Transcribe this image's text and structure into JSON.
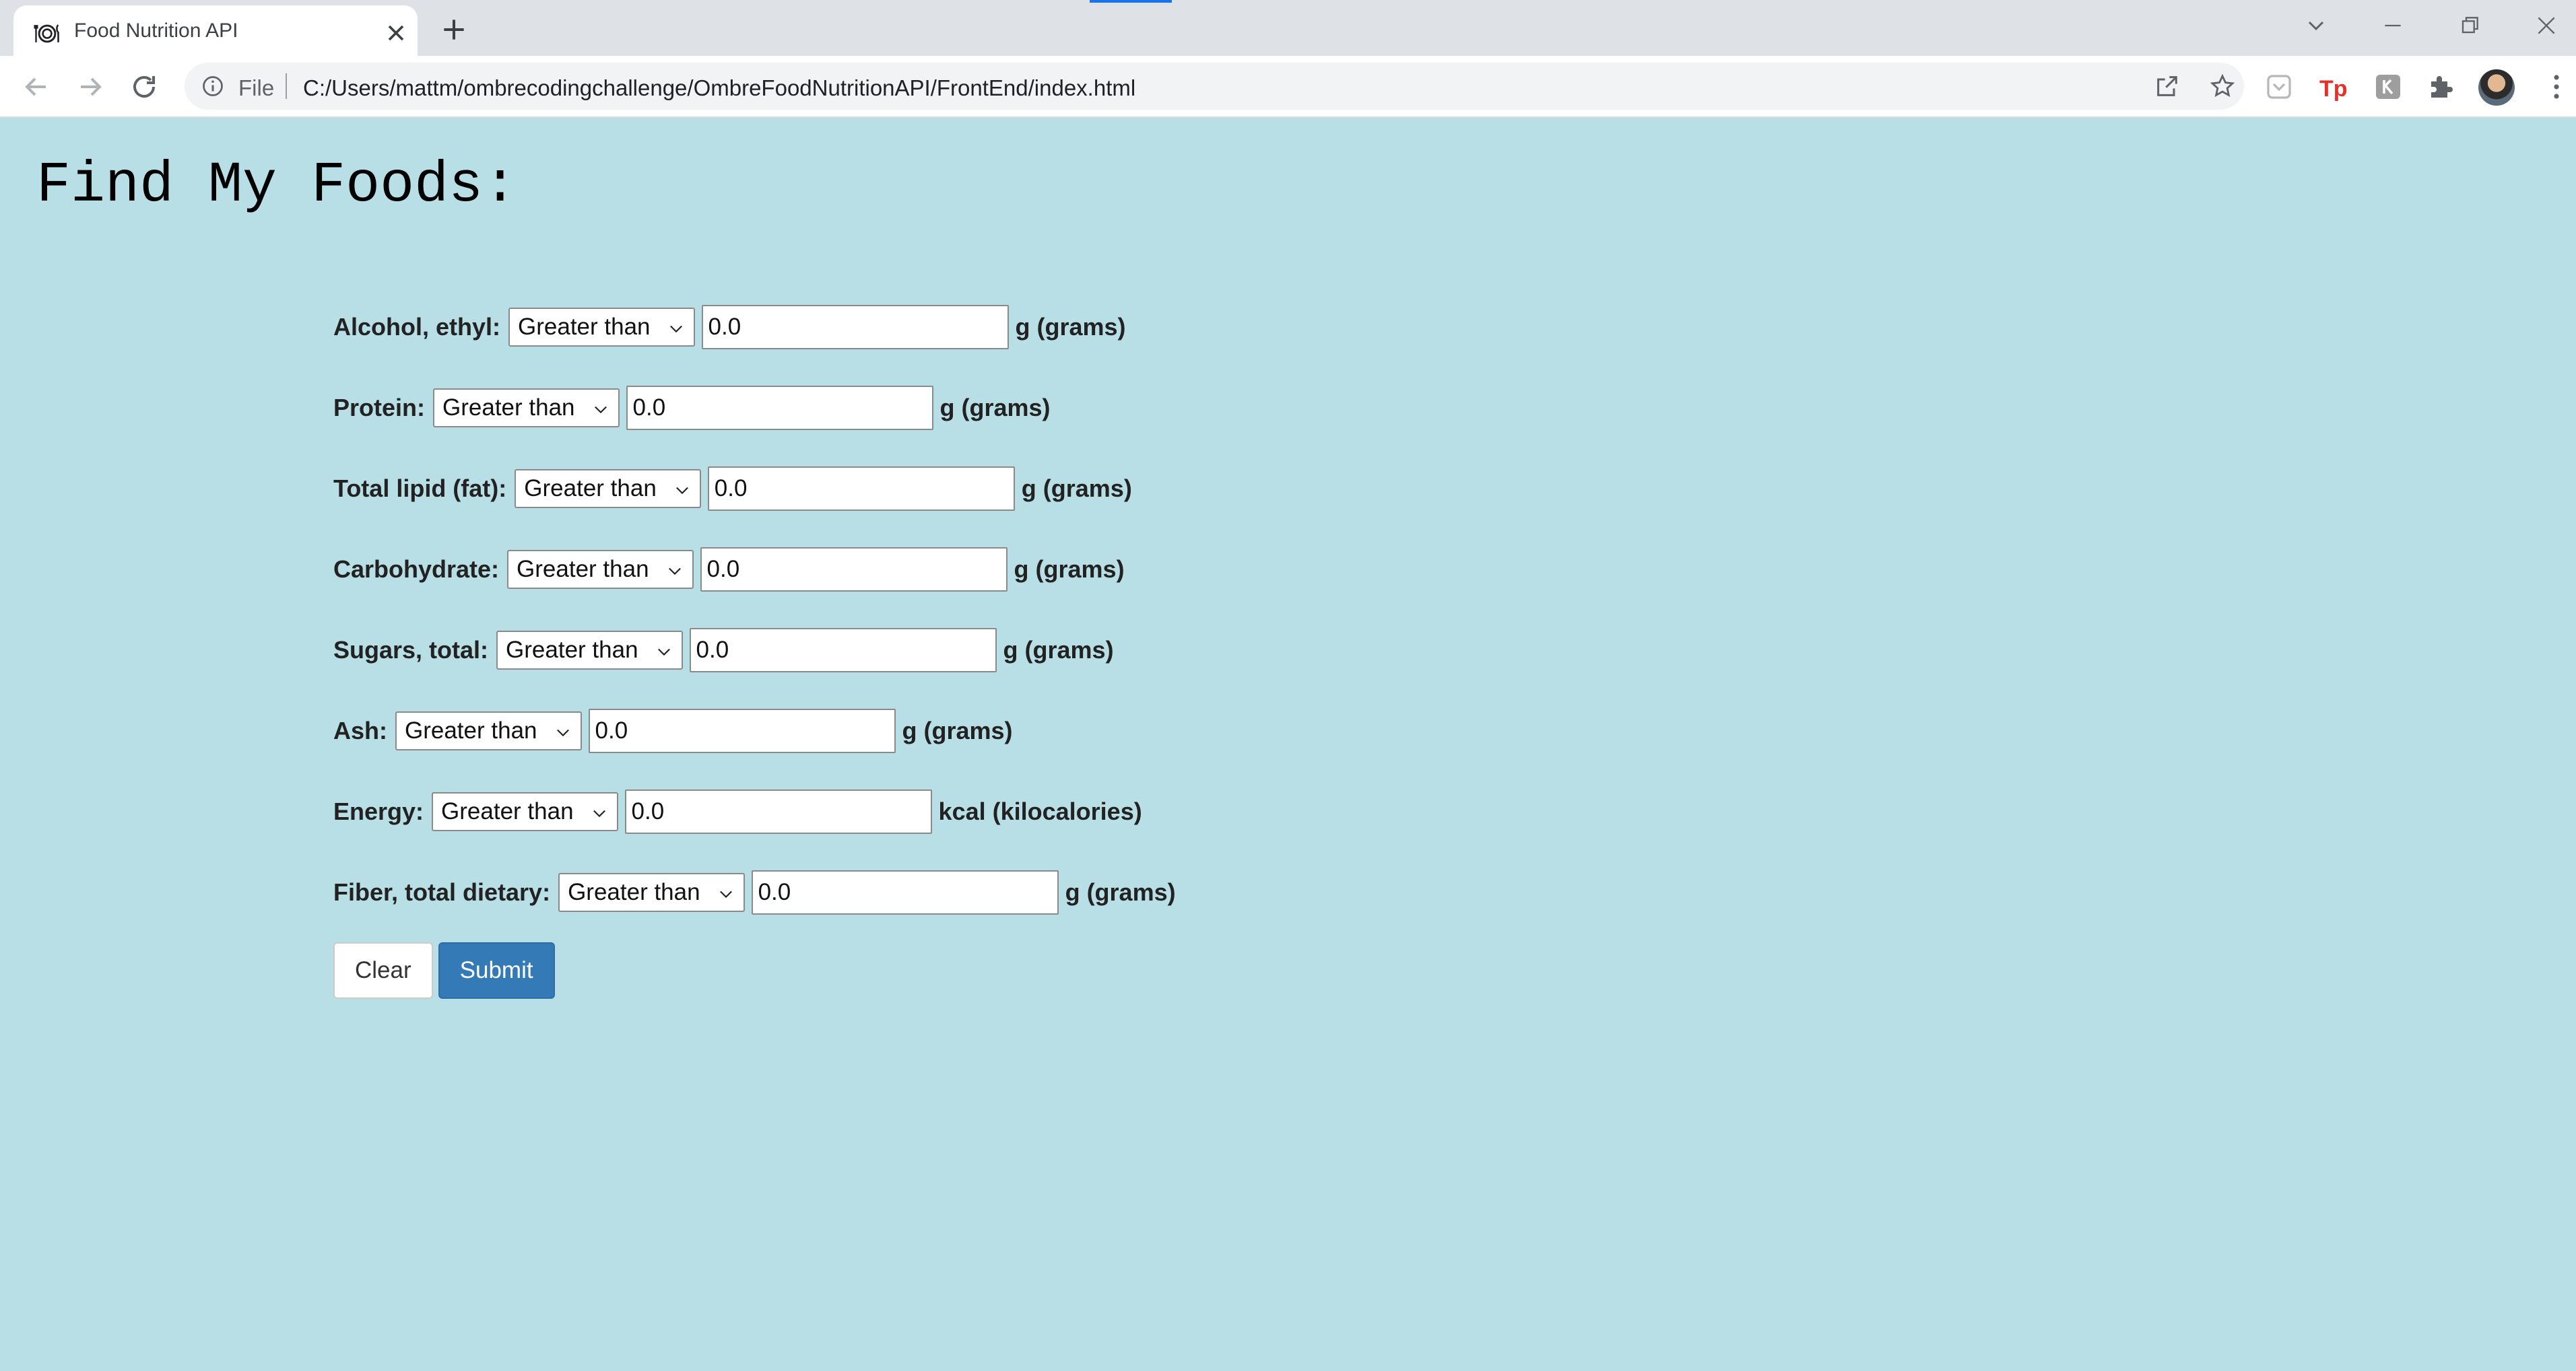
{
  "browser": {
    "tab_title": "Food Nutrition API",
    "file_label": "File",
    "url": "C:/Users/mattm/ombrecodingchallenge/OmbreFoodNutritionAPI/FrontEnd/index.html"
  },
  "page": {
    "title": "Find My Foods:"
  },
  "form": {
    "rows": [
      {
        "label": "Alcohol, ethyl:",
        "comparator": "Greater than",
        "value": "0.0",
        "unit": "g (grams)"
      },
      {
        "label": "Protein:",
        "comparator": "Greater than",
        "value": "0.0",
        "unit": "g (grams)"
      },
      {
        "label": "Total lipid (fat):",
        "comparator": "Greater than",
        "value": "0.0",
        "unit": "g (grams)"
      },
      {
        "label": "Carbohydrate:",
        "comparator": "Greater than",
        "value": "0.0",
        "unit": "g (grams)"
      },
      {
        "label": "Sugars, total:",
        "comparator": "Greater than",
        "value": "0.0",
        "unit": "g (grams)"
      },
      {
        "label": "Ash:",
        "comparator": "Greater than",
        "value": "0.0",
        "unit": "g (grams)"
      },
      {
        "label": "Energy:",
        "comparator": "Greater than",
        "value": "0.0",
        "unit": "kcal (kilocalories)"
      },
      {
        "label": "Fiber, total dietary:",
        "comparator": "Greater than",
        "value": "0.0",
        "unit": "g (grams)"
      }
    ],
    "clear_label": "Clear",
    "submit_label": "Submit"
  },
  "colors": {
    "page_background": "#b8dfe6",
    "submit_button": "#337ab7",
    "tab_strip": "#dee1e6"
  },
  "icons": {
    "favicon": "plate-cutlery-icon",
    "tab_close": "close-icon",
    "new_tab": "plus-icon",
    "back": "arrow-left-icon",
    "forward": "arrow-right-icon",
    "reload": "reload-icon",
    "site_info": "info-icon",
    "share": "share-icon",
    "bookmark": "star-icon",
    "extensions": "puzzle-icon",
    "select_chevron": "chevron-down-icon"
  }
}
